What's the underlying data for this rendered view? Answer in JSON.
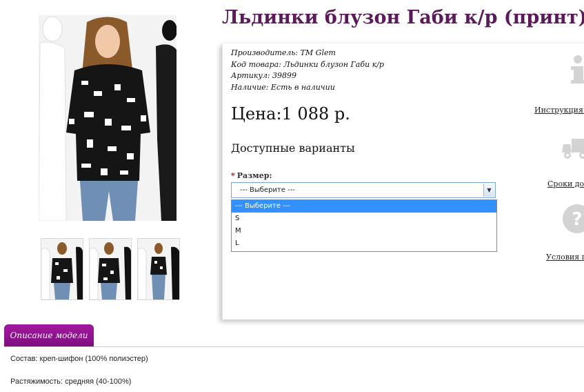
{
  "product": {
    "title": "Льдинки блузон Габи к/р (принт)",
    "specs": [
      {
        "key": "Производитель:",
        "value": " TM Glem"
      },
      {
        "key": "Код товара:",
        "value": " Льдинки блузон Габи к/р"
      },
      {
        "key": "Артикул:",
        "value": " 39899"
      },
      {
        "key": "Наличие:",
        "value": " Есть в наличии"
      }
    ],
    "price": "Цена:1 088 р.",
    "variants_title": "Доступные варианты",
    "size_label": "Размер:",
    "required_mark": "*",
    "select": {
      "selected": "--- Выберите ---",
      "options": [
        "--- Выберите ---",
        "S",
        "M",
        "L"
      ]
    }
  },
  "side_links": {
    "instruction": "Инструкция п",
    "delivery": "Сроки дос",
    "conditions": "Условия по"
  },
  "icons": {
    "info": "info-icon",
    "delivery": "truck-icon",
    "help": "question-icon",
    "dropdown": "chevron-down-icon"
  },
  "tabs": {
    "description": "Описание модели"
  },
  "description": {
    "composition_label": "Состав:",
    "composition_value": " креп-шифон (100% полиэстер)",
    "stretch_label": "Растяжимость:",
    "stretch_value": " средняя (40-100%)"
  },
  "colors": {
    "title": "#5b1a59",
    "tab": "#8e148d",
    "selected_option": "#3390ff",
    "required": "#d00000"
  }
}
